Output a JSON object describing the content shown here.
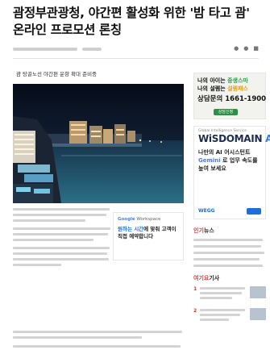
{
  "article": {
    "title": "괌정부관광청, 야간편 활성화 위한 '밤 타고 괌' 온라인 프로모션 론칭",
    "photo_caption": "괌 탕골노선 야간편 운항 확대 준비중"
  },
  "google_ad": {
    "brand_google": "Google",
    "brand_rest": " Workspace",
    "copy_a": "원하는 시간",
    "copy_b": "에 맞춰 고객이 직접 예약합니다"
  },
  "sidebar": {
    "banner_ad": {
      "line1_a": "나의 아이는 ",
      "line1_b": "중생스마",
      "line2_a": "나의 설렘는 ",
      "line2_b": "설렘패스",
      "phone": "상담문의 1661-1900",
      "chip": "상담신청"
    },
    "wis_ad": {
      "top_small": "Global Intelligence Service",
      "logo_a": "WiSDOMAIN",
      "logo_b": "AI",
      "pitch_1": "나만의 AI 어시스턴트",
      "pitch_2_a": "Gemini",
      "pitch_2_b": " 로 업무 속도를",
      "pitch_3": "높여 보세요",
      "logos": "WEGG"
    },
    "news_title_a": "인기",
    "news_title_b": "뉴스",
    "popular_title_a": "여기요",
    "popular_title_b": "기사",
    "popular_nums": [
      "1",
      "2"
    ]
  },
  "colors": {
    "accent_red": "#d93a2f",
    "banner_green": "#2e9a4b",
    "link_blue": "#1b6fd6"
  }
}
